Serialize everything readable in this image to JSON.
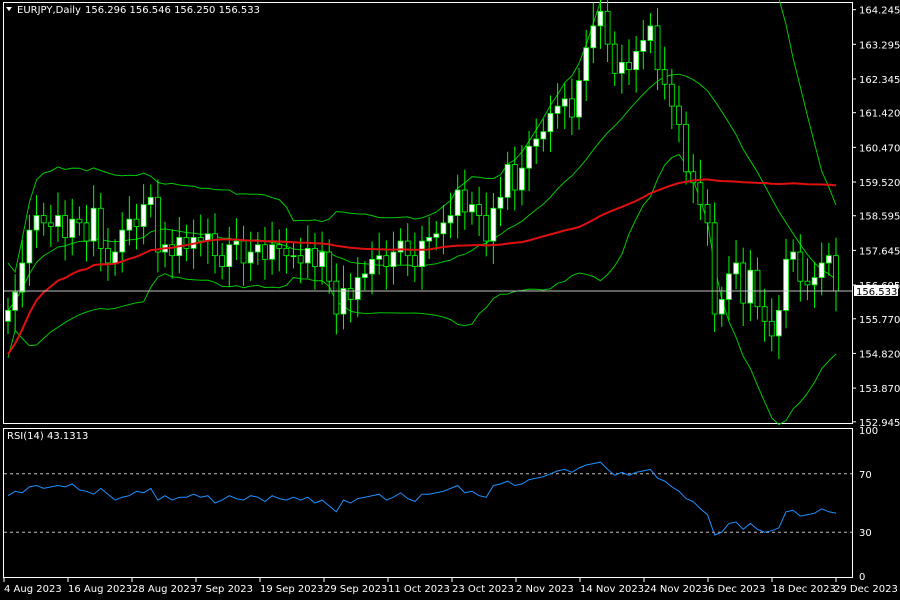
{
  "symbol_header": {
    "symbol": "EURJPY,Daily",
    "ohlc": "156.296 156.546 156.250 156.533"
  },
  "rsi_header": "RSI(14) 43.1313",
  "current_price_label": "156.533",
  "colors": {
    "background": "#000000",
    "frame": "#ffffff",
    "bull_candle": "#ffffff",
    "bear_candle": "#000000",
    "candle_outline": "#00ff00",
    "bollinger": "#00c800",
    "moving_average": "#e01010",
    "rsi_line": "#1e90ff",
    "level_lines": "#c0c0c0"
  },
  "chart_data": [
    {
      "type": "candlestick",
      "title": "EURJPY,Daily",
      "price_axis_ticks": [
        "164.245",
        "163.295",
        "162.345",
        "161.420",
        "160.470",
        "159.520",
        "158.595",
        "157.645",
        "156.695",
        "155.770",
        "154.820",
        "153.870",
        "152.945"
      ],
      "ylim": [
        152.94,
        164.4
      ],
      "date_ticks": [
        "4 Aug 2023",
        "16 Aug 2023",
        "28 Aug 2023",
        "7 Sep 2023",
        "19 Sep 2023",
        "29 Sep 2023",
        "11 Oct 2023",
        "23 Oct 2023",
        "2 Nov 2023",
        "14 Nov 2023",
        "24 Nov 2023",
        "6 Dec 2023",
        "18 Dec 2023",
        "29 Dec 2023"
      ],
      "last_price": 156.533,
      "closes": [
        156.0,
        156.5,
        157.3,
        158.2,
        158.6,
        158.4,
        158.3,
        158.6,
        158.0,
        158.5,
        158.4,
        157.9,
        158.8,
        157.7,
        157.3,
        157.6,
        158.2,
        158.5,
        158.3,
        158.9,
        159.1,
        157.6,
        157.8,
        157.5,
        158.0,
        157.7,
        158.0,
        157.9,
        158.1,
        157.5,
        157.2,
        157.8,
        157.9,
        157.3,
        157.6,
        157.8,
        157.4,
        157.8,
        157.7,
        157.5,
        157.5,
        157.3,
        157.7,
        157.2,
        157.6,
        156.8,
        155.9,
        156.6,
        156.3,
        156.9,
        157.0,
        157.4,
        157.5,
        157.2,
        157.6,
        157.9,
        157.5,
        157.2,
        157.9,
        158.0,
        158.1,
        158.4,
        158.6,
        159.3,
        158.7,
        158.9,
        158.6,
        157.9,
        158.8,
        159.1,
        160.0,
        159.3,
        159.9,
        160.5,
        160.7,
        160.9,
        161.4,
        161.6,
        161.8,
        161.3,
        162.3,
        163.2,
        163.8,
        164.2,
        163.3,
        162.5,
        162.8,
        162.6,
        163.1,
        163.4,
        163.8,
        162.6,
        162.2,
        161.6,
        161.1,
        159.8,
        159.5,
        158.9,
        158.4,
        155.9,
        156.3,
        157.0,
        157.3,
        156.2,
        157.1,
        156.1,
        155.7,
        155.3,
        156.0,
        157.4,
        157.6,
        156.8,
        156.7,
        156.9,
        157.3,
        157.5,
        156.533
      ],
      "ma_period_line": "red moving average",
      "bollinger_bands": true
    },
    {
      "type": "line",
      "title": "RSI(14) 43.1313",
      "ylim": [
        0,
        100
      ],
      "levels": [
        30,
        70
      ],
      "axis_ticks": [
        "100",
        "70",
        "30",
        "0"
      ],
      "values": [
        55,
        58,
        57,
        61,
        62,
        60,
        61,
        62,
        61,
        63,
        59,
        58,
        56,
        60,
        56,
        52,
        54,
        55,
        58,
        57,
        60,
        52,
        55,
        52,
        54,
        54,
        56,
        54,
        55,
        50,
        52,
        55,
        53,
        52,
        55,
        54,
        51,
        55,
        53,
        52,
        54,
        52,
        54,
        50,
        52,
        48,
        44,
        52,
        50,
        53,
        54,
        55,
        56,
        52,
        54,
        57,
        53,
        51,
        56,
        56,
        57,
        58,
        60,
        62,
        57,
        58,
        55,
        54,
        62,
        63,
        65,
        62,
        63,
        66,
        67,
        68,
        70,
        72,
        73,
        71,
        74,
        76,
        77,
        78,
        73,
        69,
        71,
        69,
        71,
        72,
        73,
        67,
        65,
        61,
        58,
        53,
        51,
        46,
        42,
        28,
        30,
        36,
        37,
        32,
        36,
        32,
        30,
        31,
        33,
        44,
        45,
        41,
        42,
        43,
        46,
        44,
        43.1
      ]
    }
  ]
}
